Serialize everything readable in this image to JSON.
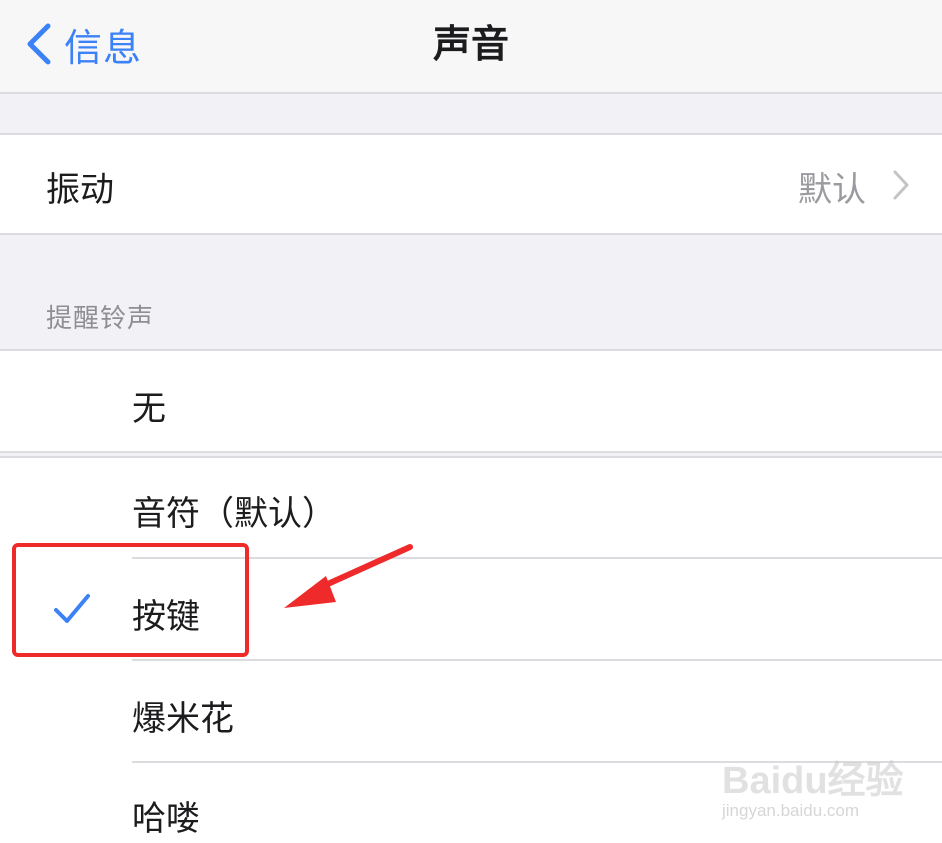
{
  "nav": {
    "back_label": "信息",
    "title": "声音"
  },
  "vibration": {
    "label": "振动",
    "value": "默认"
  },
  "alert_tones": {
    "header": "提醒铃声",
    "items": [
      {
        "label": "无",
        "selected": false
      },
      {
        "label": "音符（默认）",
        "selected": false
      },
      {
        "label": "按键",
        "selected": true
      },
      {
        "label": "爆米花",
        "selected": false
      },
      {
        "label": "哈喽",
        "selected": false
      }
    ]
  },
  "watermark": {
    "logo": "Baidu经验",
    "domain": "jingyan.baidu.com"
  },
  "colors": {
    "accent": "#3b82f6",
    "annotation": "#ee2a2a"
  }
}
